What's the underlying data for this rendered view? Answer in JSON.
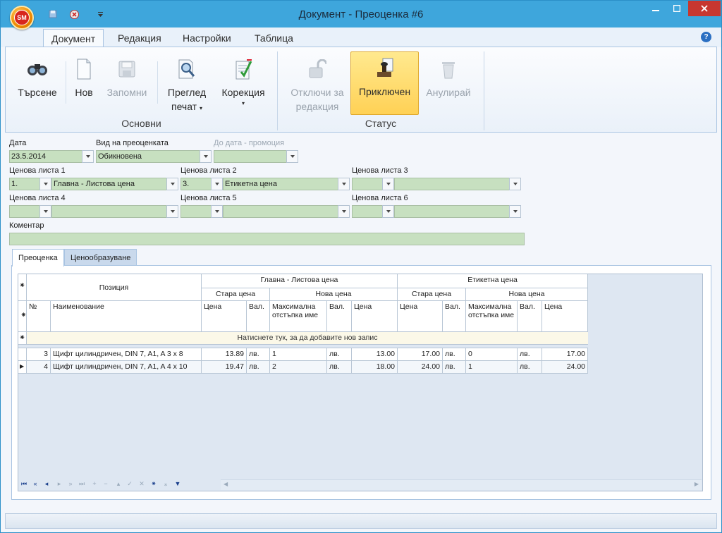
{
  "window": {
    "title": "Документ - Преоценка #6",
    "logo_text": "SM"
  },
  "ribbon": {
    "tabs": [
      "Документ",
      "Редакция",
      "Настройки",
      "Таблица"
    ],
    "buttons": {
      "search": "Търсене",
      "new": "Нов",
      "save": "Запомни",
      "preview_l1": "Преглед",
      "preview_l2": "печат",
      "correction": "Корекция",
      "unlock_l1": "Отключи за",
      "unlock_l2": "редакция",
      "completed": "Приключен",
      "cancel": "Анулирай"
    },
    "groups": {
      "basic": "Основни",
      "status": "Статус"
    }
  },
  "form": {
    "date_label": "Дата",
    "date_value": "23.5.2014",
    "type_label": "Вид на преоценката",
    "type_value": "Обикновена",
    "promo_label": "До дата - промоция",
    "pl1_label": "Ценова листа 1",
    "pl1_num": "1.",
    "pl1_name": "Главна - Листова цена",
    "pl2_label": "Ценова листа 2",
    "pl2_num": "3.",
    "pl2_name": "Етикетна цена",
    "pl3_label": "Ценова листа 3",
    "pl4_label": "Ценова листа 4",
    "pl5_label": "Ценова листа 5",
    "pl6_label": "Ценова листа 6",
    "comment_label": "Коментар"
  },
  "tabs": {
    "revaluation": "Преоценка",
    "pricing": "Ценообразуване"
  },
  "grid": {
    "band_position": "Позиция",
    "band_pl1": "Главна - Листова цена",
    "band_pl2": "Етикетна цена",
    "old_price": "Стара цена",
    "new_price": "Нова цена",
    "col_no": "№",
    "col_name": "Наименование",
    "col_price": "Цена",
    "col_cur": "Вал.",
    "col_maxdisc": "Максимална отстъпка име",
    "new_row_text": "Натиснете тук, за да добавите нов запис",
    "rows": [
      {
        "no": "3",
        "name": "Щифт цилиндричен, DIN 7, A1, A 3 x 8",
        "p1_old": "13.89",
        "p1_old_cur": "лв.",
        "p1_disc": "1",
        "p1_new_cur": "лв.",
        "p1_new": "13.00",
        "p2_old": "17.00",
        "p2_old_cur": "лв.",
        "p2_disc": "0",
        "p2_new_cur": "лв.",
        "p2_new": "17.00"
      },
      {
        "no": "4",
        "name": "Щифт цилиндричен, DIN 7, A1, A 4 x 10",
        "p1_old": "19.47",
        "p1_old_cur": "лв.",
        "p1_disc": "2",
        "p1_new_cur": "лв.",
        "p1_new": "18.00",
        "p2_old": "24.00",
        "p2_old_cur": "лв.",
        "p2_disc": "1",
        "p2_new_cur": "лв.",
        "p2_new": "24.00"
      }
    ]
  }
}
